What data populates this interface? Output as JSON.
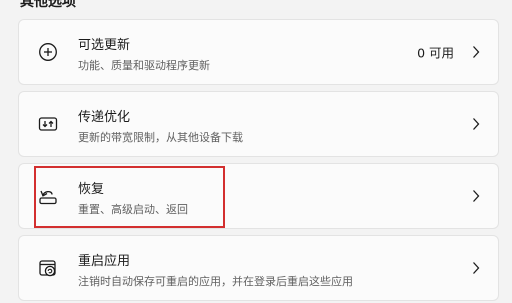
{
  "section": {
    "title": "其他选项"
  },
  "cards": [
    {
      "title": "可选更新",
      "description": "功能、质量和驱动程序更新",
      "value": "0 可用",
      "icon": "plus-circle-icon"
    },
    {
      "title": "传递优化",
      "description": "更新的带宽限制，从其他设备下载",
      "icon": "delivery-optimization-icon"
    },
    {
      "title": "恢复",
      "description": "重置、高级启动、返回",
      "icon": "recovery-icon"
    },
    {
      "title": "重启应用",
      "description": "注销时自动保存可重启的应用，并在登录后重启这些应用",
      "icon": "restart-apps-icon"
    }
  ],
  "highlight": {
    "color": "#d32f2f"
  },
  "colors": {
    "background": "#f3f3f3",
    "card": "#fbfbfb",
    "secondary_text": "#616161"
  }
}
